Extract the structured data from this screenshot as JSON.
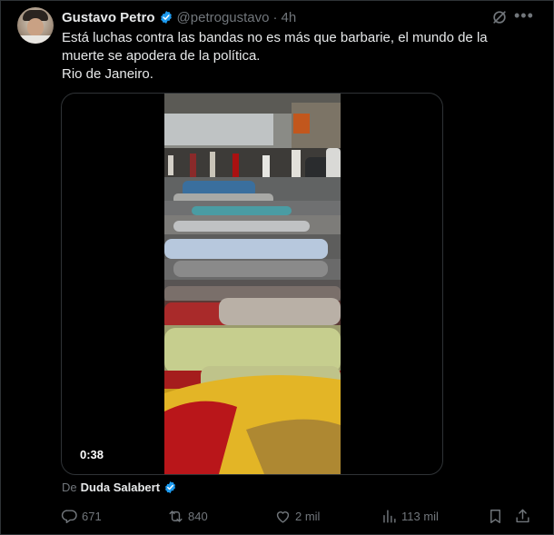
{
  "tweet": {
    "author_name": "Gustavo Petro",
    "handle": "@petrogustavo",
    "separator": "·",
    "time": "4h",
    "text_lines": [
      "Está luchas contra las bandas no es más que barbarie, el mundo de la",
      "muerte se apodera de la política.",
      "Rio de Janeiro."
    ],
    "video_duration": "0:38",
    "attribution_prefix": "De",
    "attribution_author": "Duda Salabert"
  },
  "actions": {
    "replies": "671",
    "reposts": "840",
    "likes": "2 mil",
    "views": "113 mil"
  },
  "colors": {
    "background": "#000000",
    "text": "#e7e9ea",
    "muted": "#71767b",
    "verified": "#1d9bf0",
    "border": "#2f3336"
  },
  "icons": {
    "verified": "verified-badge-icon",
    "grok": "grok-icon",
    "more": "more-icon",
    "reply": "reply-icon",
    "repost": "repost-icon",
    "like": "like-icon",
    "views": "views-icon",
    "bookmark": "bookmark-icon",
    "share": "share-icon"
  }
}
